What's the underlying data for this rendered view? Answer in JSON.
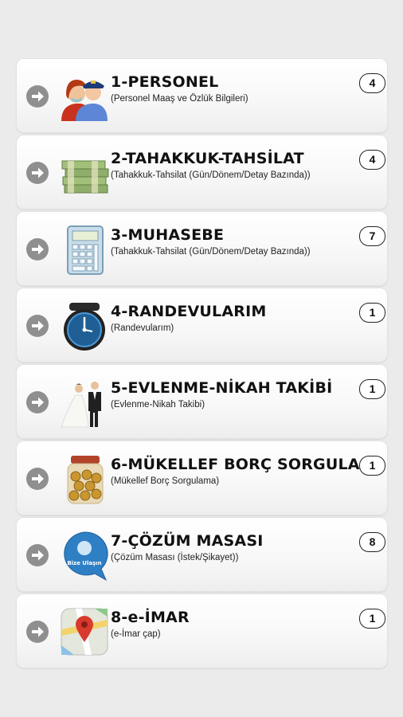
{
  "menu": {
    "items": [
      {
        "title": "1-PERSONEL",
        "subtitle": "(Personel Maaş ve Özlük Bilgileri)",
        "count": "4",
        "icon": "personnel-icon"
      },
      {
        "title": "2-TAHAKKUK-TAHSİLAT",
        "subtitle": "(Tahakkuk-Tahsilat (Gün/Dönem/Detay Bazında))",
        "count": "4",
        "icon": "money-stack-icon"
      },
      {
        "title": "3-MUHASEBE",
        "subtitle": "(Tahakkuk-Tahsilat (Gün/Dönem/Detay Bazında))",
        "count": "7",
        "icon": "calculator-icon"
      },
      {
        "title": "4-RANDEVULARIM",
        "subtitle": "(Randevularım)",
        "count": "1",
        "icon": "clock-icon"
      },
      {
        "title": "5-EVLENME-NİKAH TAKİBİ",
        "subtitle": "(Evlenme-Nikah Takibi)",
        "count": "1",
        "icon": "wedding-couple-icon"
      },
      {
        "title": "6-MÜKELLEF BORÇ SORGULA",
        "subtitle": "(Mükellef Borç Sorgulama)",
        "count": "1",
        "icon": "coin-jar-icon"
      },
      {
        "title": "7-ÇÖZÜM MASASI",
        "subtitle": "(Çözüm Masası (İstek/Şikayet))",
        "count": "8",
        "icon": "speech-bubble-icon"
      },
      {
        "title": "8-e-İMAR",
        "subtitle": "(e-İmar çap)",
        "count": "1",
        "icon": "map-pin-icon"
      }
    ]
  },
  "bubble_logo_text": "Bize Ulaşın",
  "colors": {
    "background": "#ebebeb",
    "arrow": "#8f8f8f",
    "card": "#ffffff"
  }
}
